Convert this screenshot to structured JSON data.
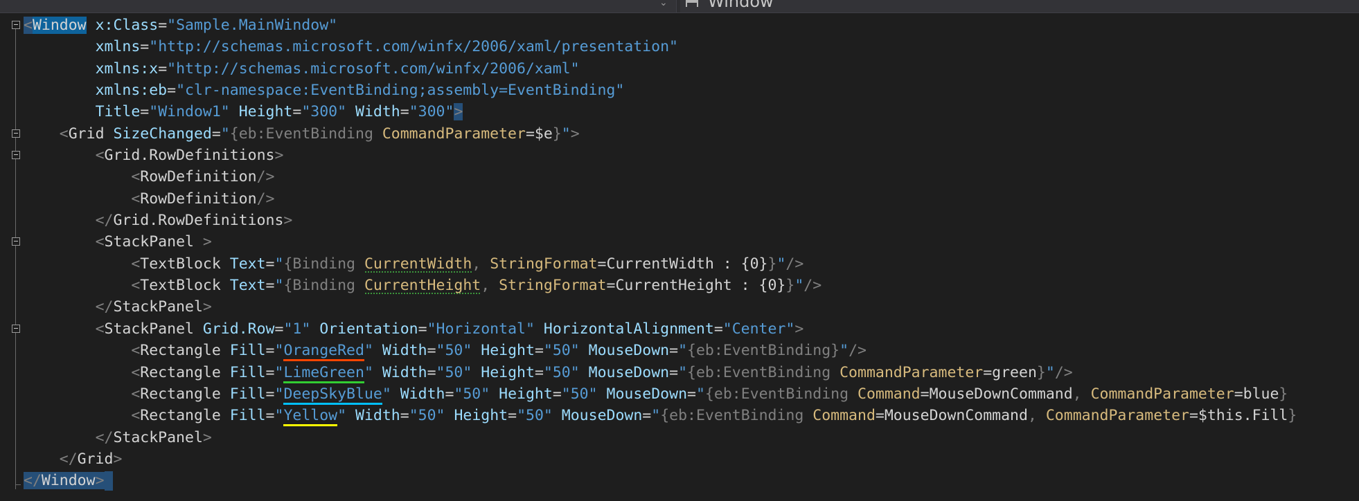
{
  "navbar": {
    "left_value": "",
    "right_value": "Window",
    "right_icon": "xaml-element-icon"
  },
  "code": {
    "l1": {
      "open": "<",
      "el": "Window",
      "attr": "x:Class",
      "val": "\"Sample.MainWindow\""
    },
    "l2": {
      "attr": "xmlns",
      "val": "\"http://schemas.microsoft.com/winfx/2006/xaml/presentation\""
    },
    "l3": {
      "attr_pfx": "xmlns",
      "attr_rest": ":x",
      "val": "\"http://schemas.microsoft.com/winfx/2006/xaml\""
    },
    "l4": {
      "attr_pfx": "xmlns",
      "attr_rest": ":eb",
      "val": "\"clr-namespace:EventBinding;assembly=EventBinding\""
    },
    "l5": {
      "a1": "Title",
      "v1": "\"Window1\"",
      "a2": "Height",
      "v2": "\"300\"",
      "a3": "Width",
      "v3": "\"300\"",
      "close": ">"
    },
    "l6": {
      "el": "Grid",
      "attr": "SizeChanged",
      "q1": "\"",
      "brace_o": "{",
      "ext_pfx": "eb",
      "ext_rest": ":EventBinding",
      "param": "CommandParameter",
      "pval": "$e",
      "brace_c": "}",
      "q2": "\""
    },
    "l7": {
      "el": "Grid.RowDefinitions"
    },
    "l8": {
      "el": "RowDefinition"
    },
    "l9": {
      "el": "RowDefinition"
    },
    "l10": {
      "el": "Grid.RowDefinitions"
    },
    "l11": {
      "el": "StackPanel"
    },
    "l12": {
      "el": "TextBlock",
      "attr": "Text",
      "binding": "Binding",
      "path": "CurrentWidth",
      "sf": "StringFormat",
      "sfval": "CurrentWidth : {0}"
    },
    "l13": {
      "el": "TextBlock",
      "attr": "Text",
      "binding": "Binding",
      "path": "CurrentHeight",
      "sf": "StringFormat",
      "sfval": "CurrentHeight : {0}"
    },
    "l14": {
      "el": "StackPanel"
    },
    "l15": {
      "el": "StackPanel",
      "a1": "Grid.Row",
      "v1": "\"1\"",
      "a2": "Orientation",
      "v2": "\"Horizontal\"",
      "a3": "HorizontalAlignment",
      "v3": "\"Center\""
    },
    "l16": {
      "el": "Rectangle",
      "fill": "Fill",
      "color": "OrangeRed",
      "w": "Width",
      "wv": "\"50\"",
      "h": "Height",
      "hv": "\"50\"",
      "md": "MouseDown",
      "ext": "eb:EventBinding"
    },
    "l17": {
      "el": "Rectangle",
      "fill": "Fill",
      "color": "LimeGreen",
      "w": "Width",
      "wv": "\"50\"",
      "h": "Height",
      "hv": "\"50\"",
      "md": "MouseDown",
      "ext": "eb:EventBinding",
      "p": "CommandParameter",
      "pv": "green"
    },
    "l18": {
      "el": "Rectangle",
      "fill": "Fill",
      "color": "DeepSkyBlue",
      "w": "Width",
      "wv": "\"50\"",
      "h": "Height",
      "hv": "\"50\"",
      "md": "MouseDown",
      "ext": "eb:EventBinding",
      "c": "Command",
      "cv": "MouseDownCommand",
      "p": "CommandParameter",
      "pv": "blue"
    },
    "l19": {
      "el": "Rectangle",
      "fill": "Fill",
      "color": "Yellow",
      "w": "Width",
      "wv": "\"50\"",
      "h": "Height",
      "hv": "\"50\"",
      "md": "MouseDown",
      "ext": "eb:EventBinding",
      "c": "Command",
      "cv": "MouseDownCommand",
      "p": "CommandParameter",
      "pv": "$this.Fill"
    },
    "l20": {
      "el": "StackPanel"
    },
    "l21": {
      "el": "Grid"
    },
    "l22": {
      "el": "Window"
    }
  },
  "colors": {
    "background": "#1e1e1e",
    "element": "#d4d4d4",
    "attribute": "#9cdcfe",
    "string": "#569cd6",
    "extension_param": "#d7ba7d",
    "delimiter": "#808080",
    "selection": "#264f78"
  }
}
